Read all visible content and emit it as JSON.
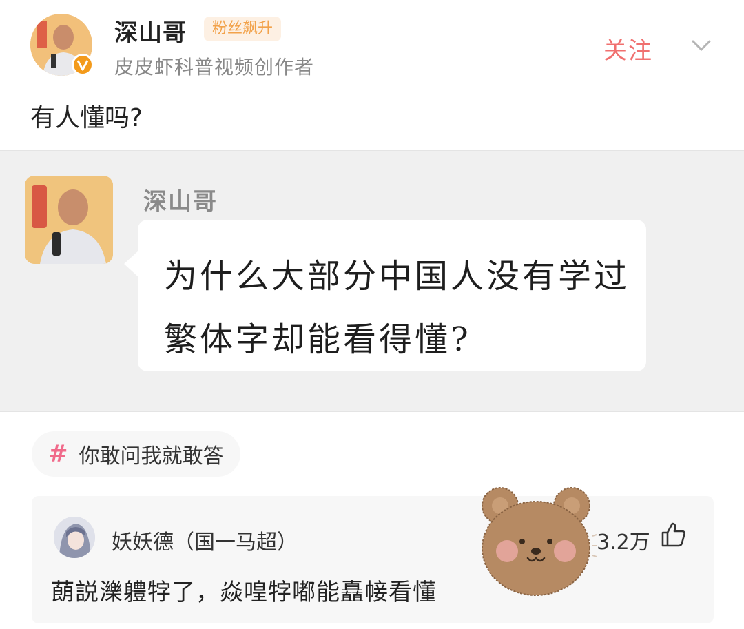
{
  "post": {
    "author_name": "深山哥",
    "badge": "粉丝飙升",
    "subtitle": "皮皮虾科普视频创作者",
    "follow_label": "关注",
    "text": "有人懂吗?"
  },
  "quote": {
    "name": "深山哥",
    "bubble_text": "为什么大部分中国人没有学过繁体字却能看得懂?"
  },
  "topic": {
    "label": "你敢问我就敢答"
  },
  "comment": {
    "name": "妖妖德（国一马超）",
    "likes": "3.2万",
    "text": "蓢説濼軆牸了，焱喤牸嘟能矗帹看懂"
  },
  "colors": {
    "accent": "#f0706f",
    "badge_text": "#f2a24a",
    "verified": "#f39a1b",
    "hashtag": "#f06a8a"
  },
  "icons": [
    "verified-icon",
    "chevron-down-icon",
    "hashtag-icon",
    "thumbs-up-icon",
    "bear-sticker-icon"
  ]
}
